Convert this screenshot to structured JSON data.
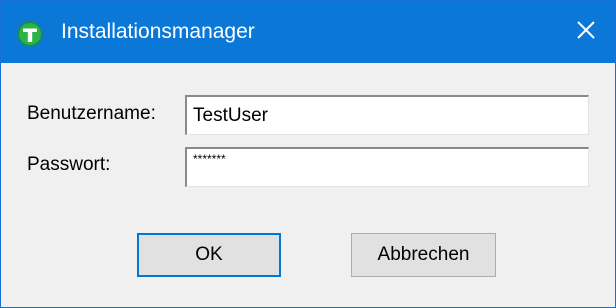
{
  "window": {
    "title": "Installationsmanager",
    "app_icon": "app-logo-icon",
    "close_icon": "close-icon",
    "accent_color": "#0b78d7"
  },
  "form": {
    "username_label": "Benutzername:",
    "username_value": "TestUser",
    "password_label": "Passwort:",
    "password_value": "*******"
  },
  "buttons": {
    "ok_label": "OK",
    "cancel_label": "Abbrechen"
  }
}
